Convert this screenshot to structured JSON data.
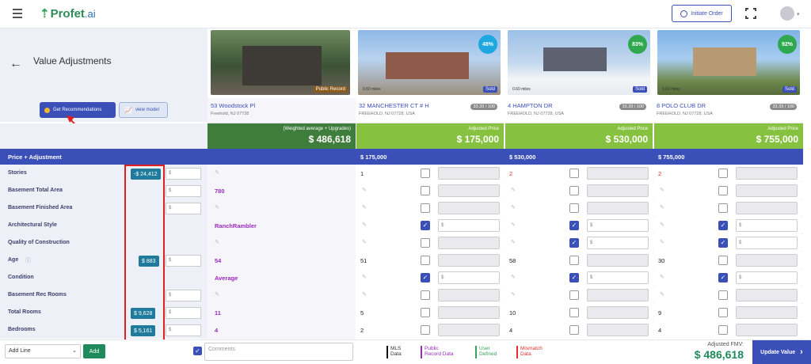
{
  "app": {
    "logo": "Profet",
    "logo_ai": ".ai",
    "initiate_order": "Initiate Order"
  },
  "page": {
    "title": "Value Adjustments"
  },
  "buttons": {
    "get_recommendations": "Get Recommendations",
    "view_model": "view model"
  },
  "subject": {
    "badge": "Public Record",
    "street": "53 Woodstock Pl",
    "city": "Freehold, NJ 07728",
    "price_label": "(Weighted average + Upgrades)",
    "price": "$ 486,618"
  },
  "comps": [
    {
      "street": "32 MANCHESTER CT # H",
      "city": "FREEHOLD, NJ 07728, USA",
      "score": "33.33 / 100",
      "pct": "48%",
      "pct_color": "#1ea7e0",
      "miles": "0.60 miles",
      "badge": "Sold",
      "price_label": "Adjusted Price",
      "price": "$ 175,000",
      "header_price": "$ 175,000"
    },
    {
      "street": "4 HAMPTON DR",
      "city": "FREEHOLD, NJ 07728, USA",
      "score": "33.33 / 100",
      "pct": "83%",
      "pct_color": "#2fa84f",
      "miles": "0.60 miles",
      "badge": "Sold",
      "price_label": "Adjusted Price",
      "price": "$ 530,000",
      "header_price": "$ 530,000"
    },
    {
      "street": "8 POLO CLUB DR",
      "city": "FREEHOLD, NJ 07728, USA",
      "score": "33.33 / 100",
      "pct": "92%",
      "pct_color": "#2fa84f",
      "miles": "0.62 miles",
      "badge": "Sold",
      "price_label": "Adjusted Price",
      "price": "$ 755,000",
      "header_price": "$ 755,000"
    }
  ],
  "table_header": "Price + Adjustment",
  "rows": [
    {
      "name": "Stories",
      "adj": "-$ 24,412",
      "dollar": "$",
      "subject": "",
      "c": [
        "1",
        "2",
        "2"
      ],
      "c_red": [
        false,
        true,
        true
      ],
      "c_chk": [
        false,
        false,
        false
      ]
    },
    {
      "name": "Basement Total Area",
      "adj": "",
      "dollar": "$",
      "subject": "780",
      "c": [
        "",
        "",
        ""
      ],
      "c_red": [
        false,
        false,
        false
      ],
      "c_chk": [
        false,
        false,
        false
      ]
    },
    {
      "name": "Basement Finished Area",
      "adj": "",
      "dollar": "$",
      "subject": "",
      "c": [
        "",
        "",
        ""
      ],
      "c_red": [
        false,
        false,
        false
      ],
      "c_chk": [
        false,
        false,
        false
      ]
    },
    {
      "name": "Architectural Style",
      "adj": "",
      "dollar": "",
      "subject": "RanchRambler",
      "c": [
        "",
        "",
        ""
      ],
      "c_red": [
        false,
        false,
        false
      ],
      "c_chk": [
        true,
        true,
        true
      ]
    },
    {
      "name": "Quality of Construction",
      "adj": "",
      "dollar": "",
      "subject": "",
      "c": [
        "",
        "",
        ""
      ],
      "c_red": [
        false,
        false,
        false
      ],
      "c_chk": [
        false,
        true,
        true
      ]
    },
    {
      "name": "Age",
      "adj": "$ 883",
      "dollar": "$",
      "subject": "54",
      "c": [
        "51",
        "58",
        "30"
      ],
      "c_red": [
        false,
        false,
        false
      ],
      "c_chk": [
        false,
        false,
        false
      ]
    },
    {
      "name": "Condition",
      "adj": "",
      "dollar": "",
      "subject": "Average",
      "c": [
        "",
        "",
        ""
      ],
      "c_red": [
        false,
        false,
        false
      ],
      "c_chk": [
        true,
        true,
        true
      ]
    },
    {
      "name": "Basement Rec Rooms",
      "adj": "",
      "dollar": "$",
      "subject": "",
      "c": [
        "",
        "",
        ""
      ],
      "c_red": [
        false,
        false,
        false
      ],
      "c_chk": [
        false,
        false,
        false
      ]
    },
    {
      "name": "Total Rooms",
      "adj": "$ 9,628",
      "dollar": "$",
      "subject": "11",
      "c": [
        "5",
        "10",
        "9"
      ],
      "c_red": [
        false,
        false,
        false
      ],
      "c_chk": [
        false,
        false,
        false
      ]
    },
    {
      "name": "Bedrooms",
      "adj": "$ 5,161",
      "dollar": "$",
      "subject": "4",
      "c": [
        "2",
        "4",
        "4"
      ],
      "c_red": [
        false,
        false,
        false
      ],
      "c_chk": [
        false,
        false,
        false
      ]
    }
  ],
  "footer": {
    "add_line": "Add Line",
    "add": "Add",
    "comments_placeholder": "Comments",
    "legend": [
      {
        "t1": "MLS",
        "t2": "Data",
        "color": "#111111"
      },
      {
        "t1": "Public",
        "t2": "Record Data",
        "color": "#9b2bbf"
      },
      {
        "t1": "User",
        "t2": "Defined",
        "color": "#3aa35a"
      },
      {
        "t1": "Mismatch",
        "t2": "Data",
        "color": "#e03030"
      }
    ],
    "fmv_label": "Adjusted FMV:",
    "fmv_value": "$ 486,618",
    "update_value": "Update Value"
  }
}
